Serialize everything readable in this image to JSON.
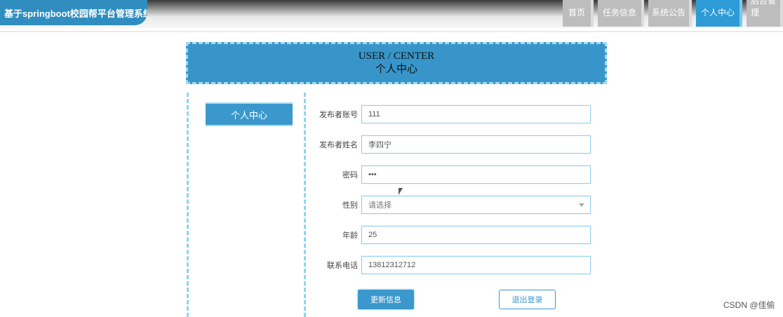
{
  "header": {
    "site_title": "基于springboot校园帮平台管理系统",
    "nav": [
      "首页",
      "任务信息",
      "系统公告",
      "个人中心",
      "后台管理"
    ],
    "active_nav_index": 3
  },
  "banner": {
    "title_en": "USER / CENTER",
    "title_cn": "个人中心"
  },
  "sidebar": {
    "items": [
      {
        "label": "个人中心",
        "active": true
      }
    ]
  },
  "form": {
    "fields": [
      {
        "label": "发布者账号",
        "value": "111"
      },
      {
        "label": "发布者姓名",
        "value": "李四宁"
      },
      {
        "label": "密码",
        "value": "•••"
      },
      {
        "label": "性别",
        "value": "请选择",
        "type": "select"
      },
      {
        "label": "年龄",
        "value": "25"
      },
      {
        "label": "联系电话",
        "value": "13812312712"
      }
    ],
    "update_label": "更新信息",
    "logout_label": "退出登录"
  },
  "watermark": "CSDN @佳偷",
  "colors": {
    "accent": "#3a98cc",
    "dashed_border": "#8fd3f2"
  }
}
